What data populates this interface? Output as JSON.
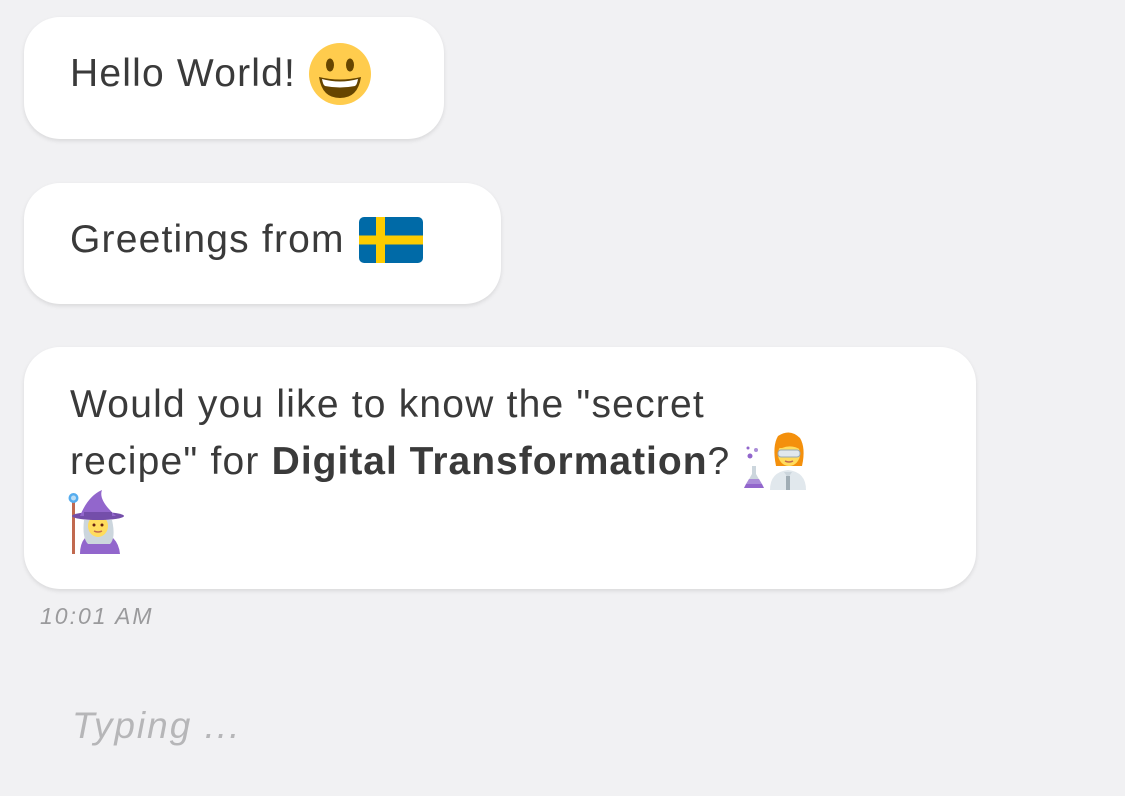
{
  "messages": [
    {
      "text": "Hello World!",
      "emoji": "grinning-face-icon"
    },
    {
      "text": "Greetings from",
      "emoji": "sweden-flag-icon"
    },
    {
      "line1": "Would you like to know the \"secret",
      "line2_prefix": "recipe\" for ",
      "line2_bold": "Digital Transformation",
      "line2_suffix": "?",
      "emojis": [
        "woman-scientist-icon",
        "woman-mage-icon"
      ]
    }
  ],
  "timestamp": "10:01 AM",
  "typing_indicator": "Typing ...",
  "colors": {
    "background": "#f1f1f3",
    "bubble": "#ffffff",
    "text": "#3a3a3a",
    "timestamp": "#9a9a9c",
    "typing": "#b6b6b8",
    "flag_blue": "#006aa7",
    "flag_yellow": "#fecc00"
  }
}
